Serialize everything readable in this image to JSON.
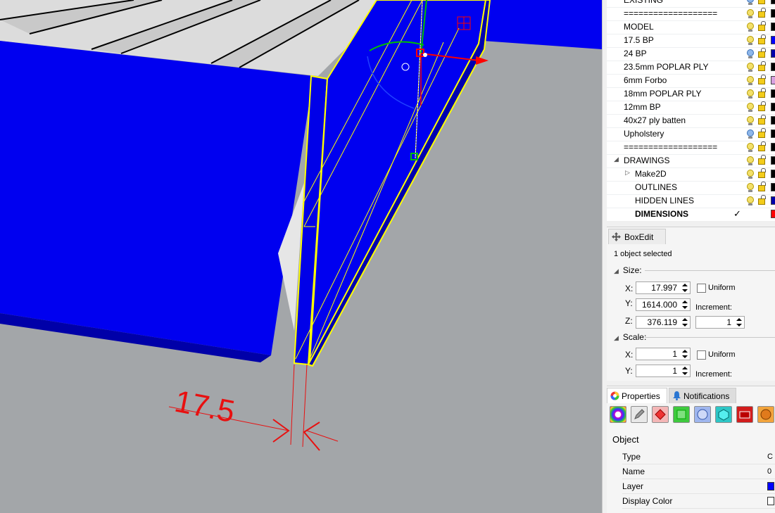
{
  "viewport": {
    "dimension_text": "17.5",
    "colors": {
      "background": "#a3a6a9",
      "panel_fill": "#0000f0",
      "selection": "#ffff00",
      "dimension": "#e81010"
    }
  },
  "layers": {
    "rows": [
      {
        "name": "EXISTING",
        "indent": 1,
        "bulb": "blue",
        "swatch": "#000000"
      },
      {
        "name": "===================",
        "indent": 1,
        "bulb": "yellow",
        "swatch": "#000000"
      },
      {
        "name": "MODEL",
        "indent": 1,
        "bulb": "yellow",
        "swatch": "#000000"
      },
      {
        "name": "17.5 BP",
        "indent": 1,
        "bulb": "yellow",
        "swatch": "#0000ff"
      },
      {
        "name": "24 BP",
        "indent": 1,
        "bulb": "blue",
        "swatch": "#0000aa"
      },
      {
        "name": "23.5mm POPLAR PLY",
        "indent": 1,
        "bulb": "yellow",
        "swatch": "#000000"
      },
      {
        "name": "6mm Forbo",
        "indent": 1,
        "bulb": "yellow",
        "swatch": "#d8a0e0"
      },
      {
        "name": "18mm POPLAR PLY",
        "indent": 1,
        "bulb": "yellow",
        "swatch": "#000000"
      },
      {
        "name": "12mm BP",
        "indent": 1,
        "bulb": "yellow",
        "swatch": "#000000"
      },
      {
        "name": "40x27 ply batten",
        "indent": 1,
        "bulb": "yellow",
        "swatch": "#000000"
      },
      {
        "name": "Upholstery",
        "indent": 1,
        "bulb": "blue",
        "swatch": "#000000"
      },
      {
        "name": "===================",
        "indent": 1,
        "bulb": "yellow",
        "swatch": "#000000"
      },
      {
        "name": "DRAWINGS",
        "indent": 1,
        "bulb": "yellow",
        "swatch": "#000000",
        "expanded": true
      },
      {
        "name": "Make2D",
        "indent": 2,
        "bulb": "yellow",
        "swatch": "#000000",
        "collapsed": true
      },
      {
        "name": "OUTLINES",
        "indent": 2,
        "bulb": "yellow",
        "swatch": "#000000"
      },
      {
        "name": "HIDDEN LINES",
        "indent": 2,
        "bulb": "yellow",
        "swatch": "#0000aa"
      },
      {
        "name": "DIMENSIONS",
        "indent": 2,
        "current": true,
        "swatch": "#ff0000"
      }
    ]
  },
  "boxedit": {
    "tab_label": "BoxEdit",
    "status": "1 object selected",
    "size_label": "Size:",
    "scale_label": "Scale:",
    "size": {
      "x": "17.997",
      "y": "1614.000",
      "z": "376.119"
    },
    "size_increment": "1",
    "scale": {
      "x": "1",
      "y": "1"
    },
    "uniform_label": "Uniform",
    "increment_label": "Increment:",
    "axis": {
      "x": "X:",
      "y": "Y:",
      "z": "Z:"
    }
  },
  "properties": {
    "tabs": {
      "properties": "Properties",
      "notifications": "Notifications"
    },
    "section": "Object",
    "rows": [
      {
        "label": "Type",
        "value": "C"
      },
      {
        "label": "Name",
        "value": "0"
      },
      {
        "label": "Layer",
        "swatch": "#0000ff"
      },
      {
        "label": "Display Color",
        "swatch": "#ffffff"
      }
    ]
  }
}
